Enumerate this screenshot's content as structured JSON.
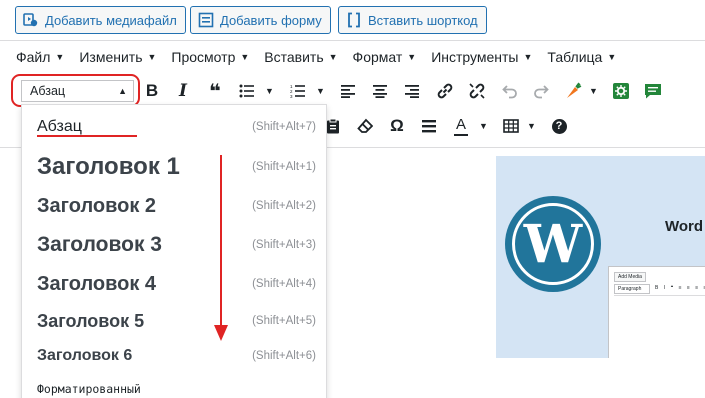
{
  "media_buttons": {
    "add_media": "Добавить медиафайл",
    "add_form": "Добавить форму",
    "insert_shortcode": "Вставить шорткод"
  },
  "menubar": [
    {
      "label": "Файл"
    },
    {
      "label": "Изменить"
    },
    {
      "label": "Просмотр"
    },
    {
      "label": "Вставить"
    },
    {
      "label": "Формат"
    },
    {
      "label": "Инструменты"
    },
    {
      "label": "Таблица"
    }
  ],
  "toolbar": {
    "format_select_value": "Абзац",
    "icons": [
      "bold-icon",
      "italic-icon",
      "blockquote-icon",
      "bullet-list-icon",
      "numbered-list-icon",
      "align-left-icon",
      "align-center-icon",
      "align-right-icon",
      "link-icon",
      "unlink-icon",
      "undo-icon",
      "redo-icon",
      "carrot-icon",
      "settings-icon",
      "comment-icon",
      "paste-text-icon",
      "clear-formatting-icon",
      "special-character-icon",
      "horizontal-line-icon",
      "text-color-icon",
      "table-icon",
      "help-icon"
    ],
    "bold_glyph": "B",
    "italic_glyph": "I",
    "quote_glyph": "❝",
    "omega_glyph": "Ω",
    "textcolor_glyph": "A",
    "help_glyph": "?"
  },
  "format_dropdown": {
    "items": [
      {
        "label": "Абзац",
        "shortcut": "(Shift+Alt+7)"
      },
      {
        "label": "Заголовок 1",
        "shortcut": "(Shift+Alt+1)"
      },
      {
        "label": "Заголовок 2",
        "shortcut": "(Shift+Alt+2)"
      },
      {
        "label": "Заголовок 3",
        "shortcut": "(Shift+Alt+3)"
      },
      {
        "label": "Заголовок 4",
        "shortcut": "(Shift+Alt+4)"
      },
      {
        "label": "Заголовок 5",
        "shortcut": "(Shift+Alt+5)"
      },
      {
        "label": "Заголовок 6",
        "shortcut": "(Shift+Alt+6)"
      },
      {
        "label": "Форматированный",
        "shortcut": ""
      }
    ]
  },
  "preview": {
    "title": "Word",
    "logo_letter": "W",
    "mini_add_media": "Add Media",
    "mini_select": "Paragraph"
  },
  "colors": {
    "accent": "#2271b1",
    "annotation_red": "#e02424",
    "wp_blue": "#21759b",
    "preview_bg": "#d4e4f4",
    "carrot_orange": "#f0761e",
    "green_icon": "#23863a"
  }
}
